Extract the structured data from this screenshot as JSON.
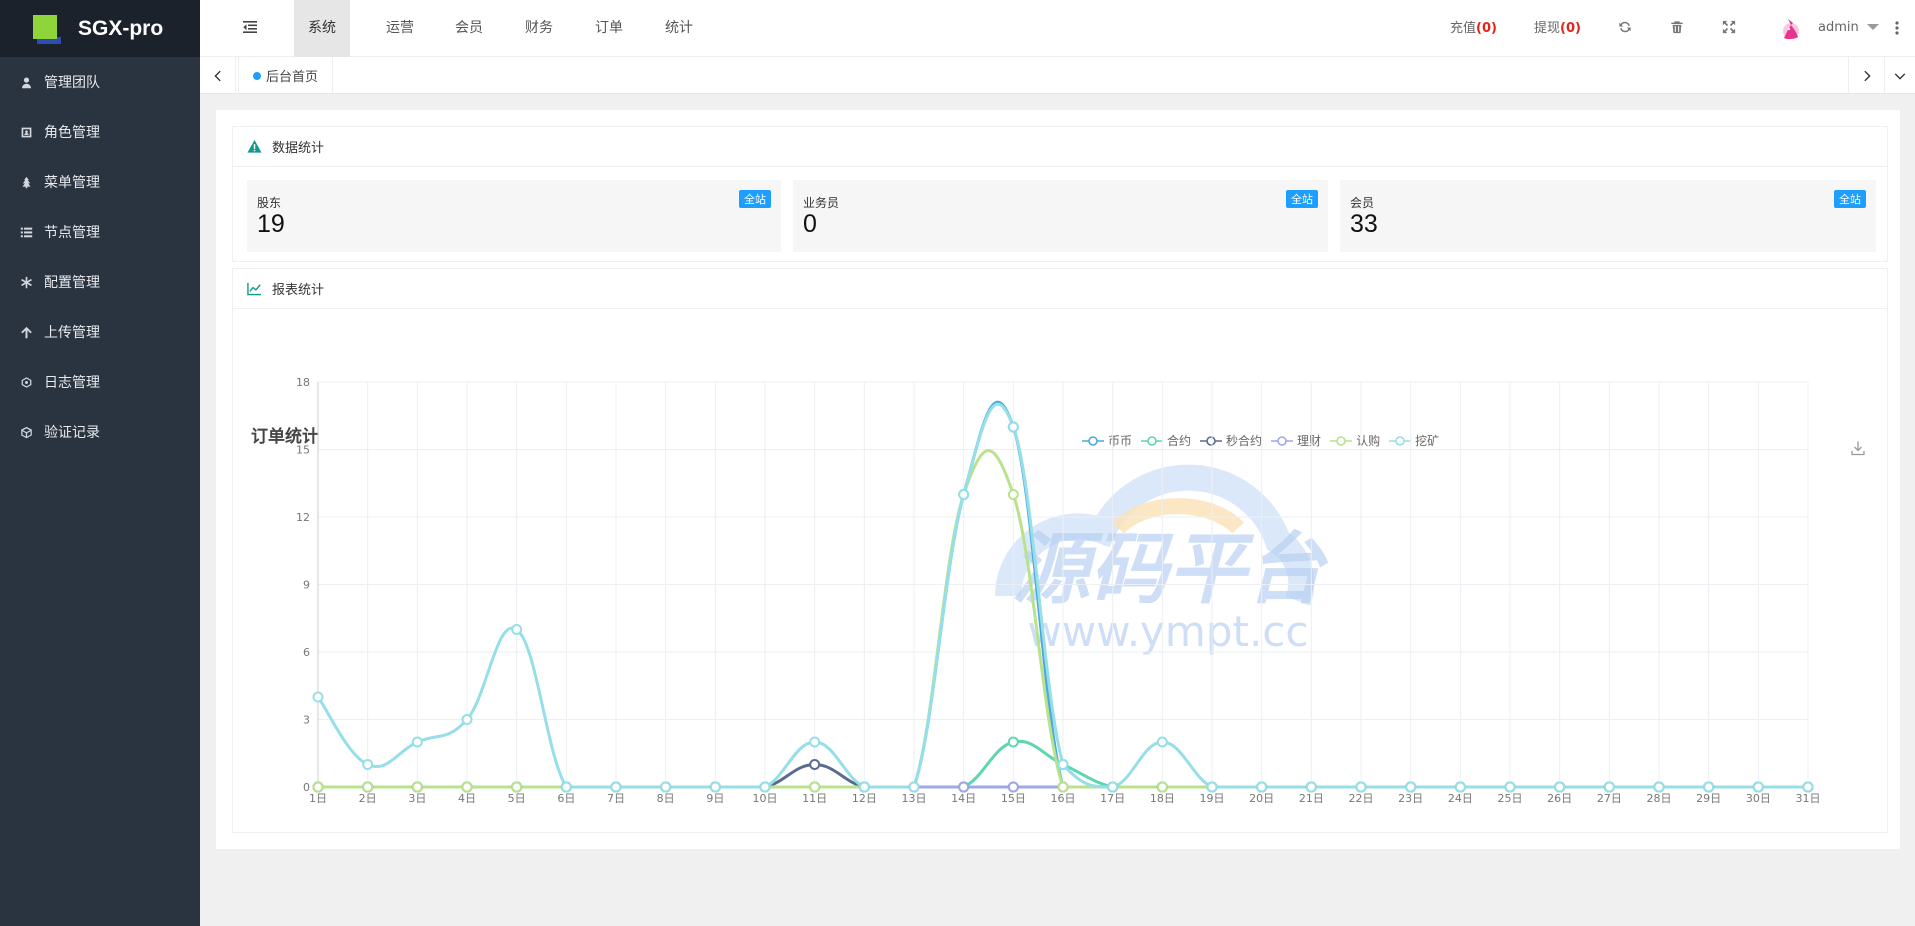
{
  "brand": {
    "name": "SGX-pro"
  },
  "sidebar": {
    "items": [
      {
        "label": "管理团队",
        "icon": "user-icon"
      },
      {
        "label": "角色管理",
        "icon": "id-card-icon"
      },
      {
        "label": "菜单管理",
        "icon": "tree-icon"
      },
      {
        "label": "节点管理",
        "icon": "list-icon"
      },
      {
        "label": "配置管理",
        "icon": "asterisk-icon"
      },
      {
        "label": "上传管理",
        "icon": "upload-icon"
      },
      {
        "label": "日志管理",
        "icon": "log-icon"
      },
      {
        "label": "验证记录",
        "icon": "cube-icon"
      }
    ]
  },
  "topbar": {
    "nav": [
      "系统",
      "运营",
      "会员",
      "财务",
      "订单",
      "统计"
    ],
    "active_nav": "系统",
    "recharge_label": "充值",
    "recharge_count": "(0)",
    "withdraw_label": "提现",
    "withdraw_count": "(0)",
    "user": "admin"
  },
  "tabs": {
    "home": "后台首页"
  },
  "stats_panel": {
    "title": "数据统计",
    "cards": [
      {
        "label": "股东",
        "value": "19",
        "badge": "全站"
      },
      {
        "label": "业务员",
        "value": "0",
        "badge": "全站"
      },
      {
        "label": "会员",
        "value": "33",
        "badge": "全站"
      }
    ]
  },
  "report_panel": {
    "title": "报表统计"
  },
  "watermark": {
    "text": "源码平台",
    "url": "www.ympt.cc"
  },
  "colors": {
    "accent": "#1e9fff",
    "sidebar_bg": "#2a3441",
    "brand_bg": "#1b222c",
    "badge_red": "#e2231a"
  },
  "chart_data": {
    "type": "line",
    "title": "订单统计",
    "x": [
      "1日",
      "2日",
      "3日",
      "4日",
      "5日",
      "6日",
      "7日",
      "8日",
      "9日",
      "10日",
      "11日",
      "12日",
      "13日",
      "14日",
      "15日",
      "16日",
      "17日",
      "18日",
      "19日",
      "20日",
      "21日",
      "22日",
      "23日",
      "24日",
      "25日",
      "26日",
      "27日",
      "28日",
      "29日",
      "30日",
      "31日"
    ],
    "ylim": [
      0,
      18
    ],
    "yticks": [
      0,
      3,
      6,
      9,
      12,
      15,
      18
    ],
    "grid": true,
    "legend_position": "top-center",
    "series": [
      {
        "name": "币币",
        "color": "#4aa8df",
        "values": [
          0,
          0,
          0,
          0,
          0,
          0,
          0,
          0,
          0,
          0,
          0,
          0,
          0,
          13,
          16,
          0,
          0,
          0,
          0,
          0,
          0,
          0,
          0,
          0,
          0,
          0,
          0,
          0,
          0,
          0,
          0
        ]
      },
      {
        "name": "合约",
        "color": "#5ed6b0",
        "values": [
          0,
          0,
          0,
          0,
          0,
          0,
          0,
          0,
          0,
          0,
          0,
          0,
          0,
          0,
          2,
          1,
          0,
          0,
          0,
          0,
          0,
          0,
          0,
          0,
          0,
          0,
          0,
          0,
          0,
          0,
          0
        ]
      },
      {
        "name": "秒合约",
        "color": "#5b6b8f",
        "values": [
          0,
          0,
          0,
          0,
          0,
          0,
          0,
          0,
          0,
          0,
          1,
          0,
          0,
          0,
          0,
          0,
          0,
          0,
          0,
          0,
          0,
          0,
          0,
          0,
          0,
          0,
          0,
          0,
          0,
          0,
          0
        ]
      },
      {
        "name": "理财",
        "color": "#a0a7e6",
        "values": [
          0,
          0,
          0,
          0,
          0,
          0,
          0,
          0,
          0,
          0,
          0,
          0,
          0,
          0,
          0,
          0,
          0,
          0,
          0,
          0,
          0,
          0,
          0,
          0,
          0,
          0,
          0,
          0,
          0,
          0,
          0
        ]
      },
      {
        "name": "认购",
        "color": "#b9e28c",
        "values": [
          0,
          0,
          0,
          0,
          0,
          0,
          0,
          0,
          0,
          0,
          0,
          0,
          0,
          13,
          13,
          0,
          0,
          0,
          0,
          0,
          0,
          0,
          0,
          0,
          0,
          0,
          0,
          0,
          0,
          0,
          0
        ]
      },
      {
        "name": "挖矿",
        "color": "#96dee8",
        "values": [
          4,
          1,
          2,
          3,
          7,
          0,
          0,
          0,
          0,
          0,
          2,
          0,
          0,
          13,
          16,
          1,
          0,
          2,
          0,
          0,
          0,
          0,
          0,
          0,
          0,
          0,
          0,
          0,
          0,
          0,
          0
        ]
      }
    ]
  }
}
